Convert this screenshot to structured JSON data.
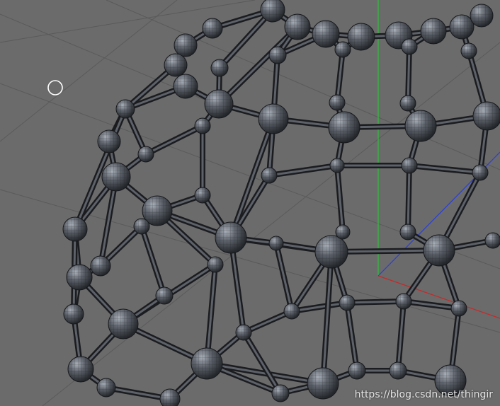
{
  "viewport": {
    "background": "#6b6b6b",
    "grid_color": "#5e5e5e",
    "axis_colors": {
      "y": "#2fbf3a",
      "x": "#c82828",
      "z": "#2b3fd6"
    },
    "strut_color": "#2a2c30",
    "node_color": "#4a4e55",
    "watermark": "https://blog.csdn.net/thingir"
  }
}
